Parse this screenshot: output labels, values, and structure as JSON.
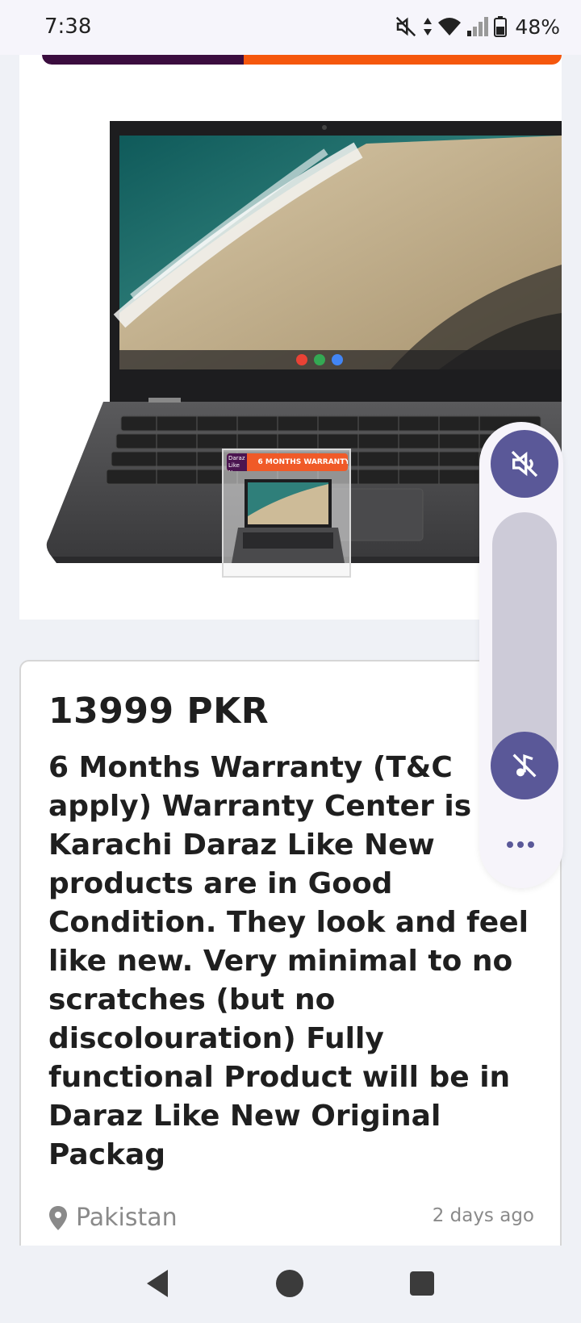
{
  "status_bar": {
    "time": "7:38",
    "battery": "48%",
    "icons": [
      "mute-icon",
      "data-arrows-icon",
      "wifi-icon",
      "signal-icon",
      "battery-icon"
    ]
  },
  "listing": {
    "banner_colors": {
      "left": "#3b0d3f",
      "right": "#f5570d"
    },
    "thumbnail_badge": "6 MONTHS WARRANTY",
    "thumbnail_logo": "Daraz Like New",
    "price": "13999 PKR",
    "description": "6 Months Warranty (T&C apply) Warranty Center is in Karachi Daraz Like New products are in Good Condition. They look and feel like new. Very minimal to no scratches (but no discolouration) Fully functional Product will be in Daraz Like New Original Packag",
    "location": "Pakistan",
    "posted": "2 days ago"
  },
  "volume_panel": {
    "accent": "#5a5898",
    "icons": [
      "volume-mute-icon",
      "music-mute-icon",
      "more-options-icon"
    ]
  },
  "nav": {
    "icons": [
      "back-icon",
      "home-icon",
      "recents-icon"
    ]
  }
}
